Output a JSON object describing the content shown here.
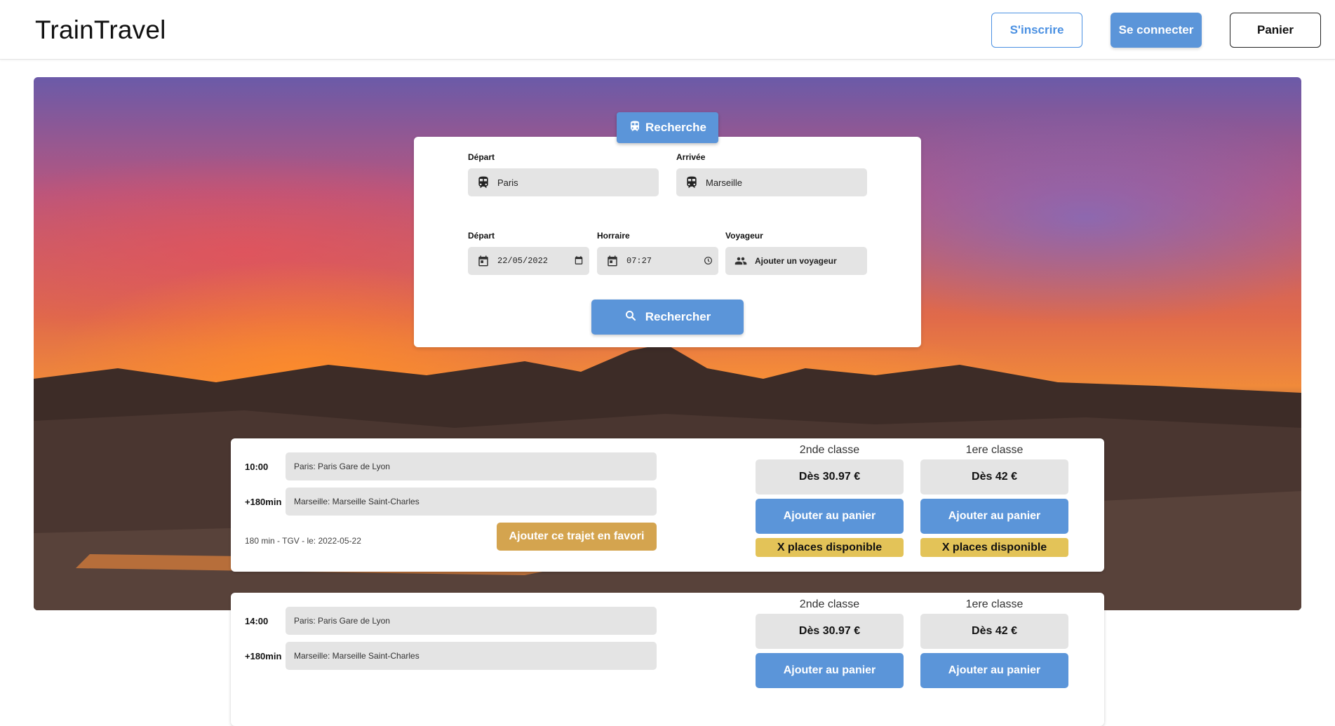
{
  "header": {
    "brand": "TrainTravel",
    "signup_label": "S'inscrire",
    "login_label": "Se connecter",
    "cart_label": "Panier"
  },
  "search": {
    "tab_label": "Recherche",
    "departure_label": "Départ",
    "departure_value": "Paris",
    "arrival_label": "Arrivée",
    "arrival_value": "Marseille",
    "date_label": "Départ",
    "date_value": "22/05/2022",
    "time_label": "Horraire",
    "time_value": "07:27",
    "traveler_label": "Voyageur",
    "traveler_value": "Ajouter un voyageur",
    "submit_label": "Rechercher"
  },
  "results": [
    {
      "depart_time": "10:00",
      "depart_station": "Paris: Paris Gare de Lyon",
      "arrival_offset": "+180min",
      "arrival_station": "Marseille: Marseille Saint-Charles",
      "info": "180 min - TGV - le: 2022-05-22",
      "favorite_label": "Ajouter ce trajet en favori",
      "second_class": {
        "title": "2nde classe",
        "price": "Dès 30.97 €",
        "add_label": "Ajouter au panier",
        "places": "X places disponible"
      },
      "first_class": {
        "title": "1ere classe",
        "price": "Dès 42 €",
        "add_label": "Ajouter au panier",
        "places": "X places disponible"
      }
    },
    {
      "depart_time": "14:00",
      "depart_station": "Paris: Paris Gare de Lyon",
      "arrival_offset": "+180min",
      "arrival_station": "Marseille: Marseille Saint-Charles",
      "second_class": {
        "title": "2nde classe",
        "price": "Dès 30.97 €",
        "add_label": "Ajouter au panier"
      },
      "first_class": {
        "title": "1ere classe",
        "price": "Dès 42 €",
        "add_label": "Ajouter au panier"
      }
    }
  ],
  "colors": {
    "primary": "#5b95d9",
    "favorite": "#d4a44f",
    "places": "#e3c358"
  }
}
